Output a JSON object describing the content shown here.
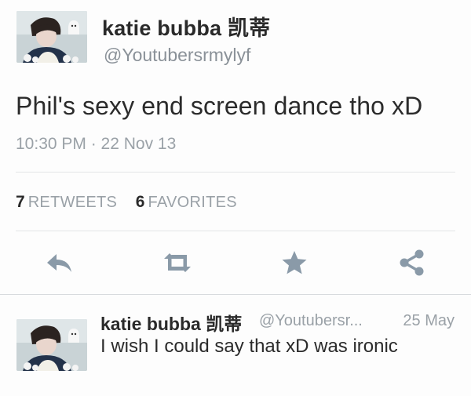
{
  "tweet": {
    "author_name": "katie bubba 凯蒂",
    "author_handle": "@Youtubersrmylyf",
    "text": "Phil's sexy end screen dance tho xD",
    "meta": "10:30 PM · 22 Nov 13",
    "retweets_count": "7",
    "retweets_label": "RETWEETS",
    "favorites_count": "6",
    "favorites_label": "FAVORITES"
  },
  "actions": [
    {
      "icon": "reply-icon"
    },
    {
      "icon": "retweet-icon"
    },
    {
      "icon": "favorite-star-icon"
    },
    {
      "icon": "share-icon"
    }
  ],
  "reply": {
    "author_name": "katie bubba 凯蒂",
    "author_handle": "@Youtubersr...",
    "time": "25 May",
    "text": "I wish I could say that xD was ironic"
  },
  "colors": {
    "action_icon": "#8a9aa8",
    "muted_text": "#9aa1a7",
    "primary_text": "#2b2b2b"
  }
}
